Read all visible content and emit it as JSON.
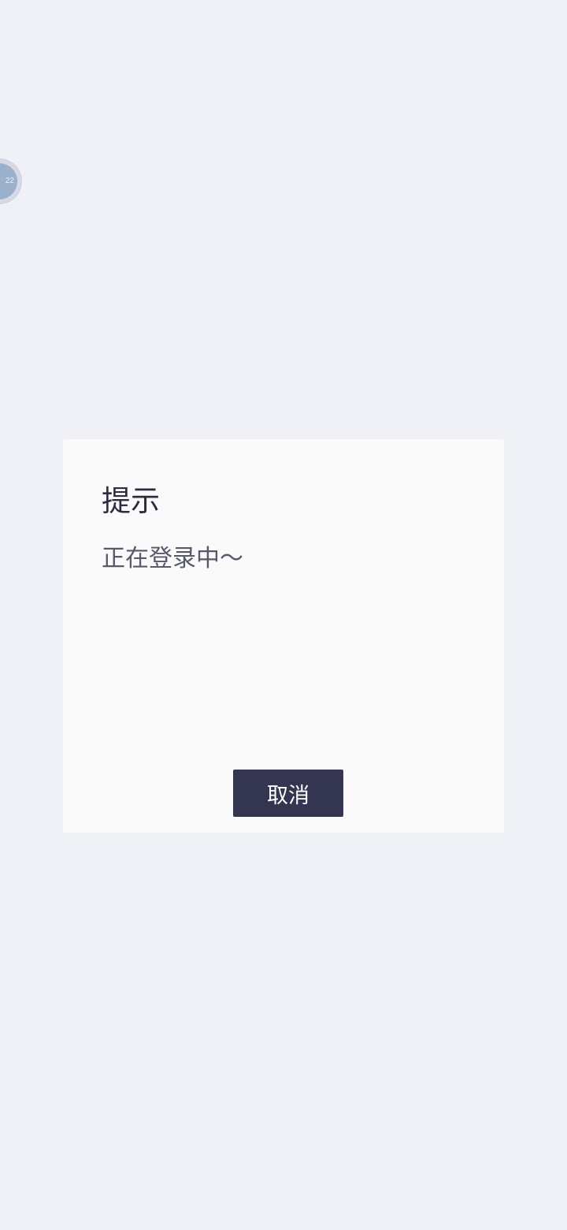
{
  "floating_bubble": {
    "text": "22"
  },
  "dialog": {
    "title": "提示",
    "message": "正在登录中～",
    "cancel_label": "取消"
  },
  "colors": {
    "background": "#eff1f7",
    "dialog_background": "#fafafa",
    "button_background": "#343651",
    "title_text": "#2b2d3f",
    "message_text": "#575a6b"
  }
}
